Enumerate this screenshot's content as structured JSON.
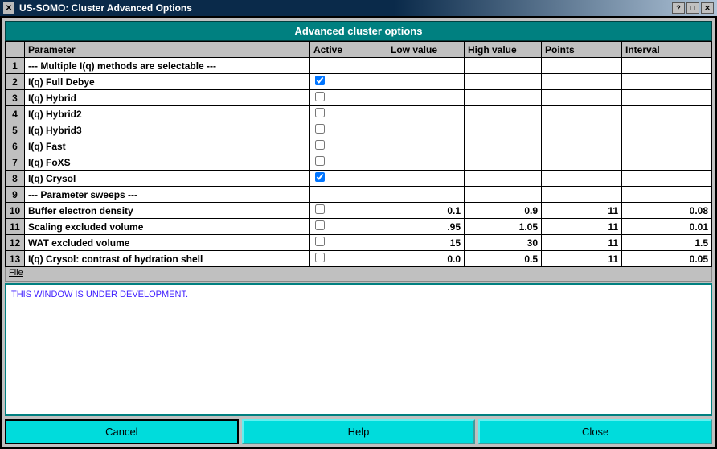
{
  "window": {
    "title": "US-SOMO: Cluster Advanced Options"
  },
  "header": "Advanced cluster options",
  "columns": {
    "param": "Parameter",
    "active": "Active",
    "low": "Low value",
    "high": "High value",
    "points": "Points",
    "interval": "Interval"
  },
  "rows": [
    {
      "n": "1",
      "param": "--- Multiple I(q) methods are selectable ---",
      "checked": null,
      "low": "",
      "high": "",
      "points": "",
      "interval": ""
    },
    {
      "n": "2",
      "param": "I(q) Full Debye",
      "checked": true,
      "low": "",
      "high": "",
      "points": "",
      "interval": ""
    },
    {
      "n": "3",
      "param": "I(q) Hybrid",
      "checked": false,
      "low": "",
      "high": "",
      "points": "",
      "interval": ""
    },
    {
      "n": "4",
      "param": "I(q) Hybrid2",
      "checked": false,
      "low": "",
      "high": "",
      "points": "",
      "interval": ""
    },
    {
      "n": "5",
      "param": "I(q) Hybrid3",
      "checked": false,
      "low": "",
      "high": "",
      "points": "",
      "interval": ""
    },
    {
      "n": "6",
      "param": "I(q) Fast",
      "checked": false,
      "low": "",
      "high": "",
      "points": "",
      "interval": ""
    },
    {
      "n": "7",
      "param": "I(q) FoXS",
      "checked": false,
      "low": "",
      "high": "",
      "points": "",
      "interval": ""
    },
    {
      "n": "8",
      "param": "I(q) Crysol",
      "checked": true,
      "low": "",
      "high": "",
      "points": "",
      "interval": ""
    },
    {
      "n": "9",
      "param": "--- Parameter sweeps ---",
      "checked": null,
      "low": "",
      "high": "",
      "points": "",
      "interval": ""
    },
    {
      "n": "10",
      "param": "Buffer electron density",
      "checked": false,
      "low": "0.1",
      "high": "0.9",
      "points": "11",
      "interval": "0.08"
    },
    {
      "n": "11",
      "param": "Scaling excluded volume",
      "checked": false,
      "low": ".95",
      "high": "1.05",
      "points": "11",
      "interval": "0.01"
    },
    {
      "n": "12",
      "param": "WAT excluded volume",
      "checked": false,
      "low": "15",
      "high": "30",
      "points": "11",
      "interval": "1.5"
    },
    {
      "n": "13",
      "param": "I(q) Crysol: contrast of hydration shell",
      "checked": false,
      "low": "0.0",
      "high": "0.5",
      "points": "11",
      "interval": "0.05"
    }
  ],
  "menu": {
    "file": "File"
  },
  "console": "THIS WINDOW IS UNDER DEVELOPMENT.",
  "buttons": {
    "cancel": "Cancel",
    "help": "Help",
    "close": "Close"
  }
}
